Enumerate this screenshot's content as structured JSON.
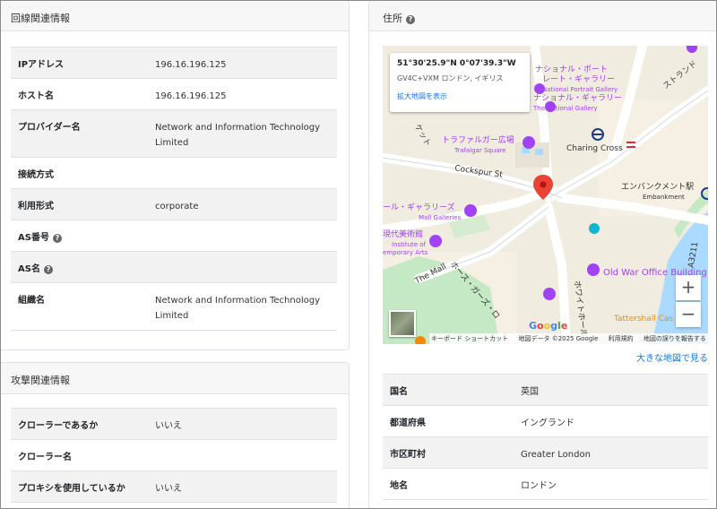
{
  "left_card": {
    "title": "回線関連情報",
    "rows": [
      {
        "key": "IPアドレス",
        "value": "196.16.196.125"
      },
      {
        "key": "ホスト名",
        "value": "196.16.196.125"
      },
      {
        "key": "プロバイダー名",
        "value": "Network and Information Technology Limited"
      },
      {
        "key": "接続方式",
        "value": ""
      },
      {
        "key": "利用形式",
        "value": "corporate"
      },
      {
        "key": "AS番号",
        "value": ""
      },
      {
        "key": "AS名",
        "value": ""
      },
      {
        "key": "組織名",
        "value": "Network and Information Technology Limited"
      }
    ],
    "help_symbol": "?"
  },
  "attack_card": {
    "title": "攻撃関連情報",
    "rows": [
      {
        "key": "クローラーであるか",
        "value": "いいえ"
      },
      {
        "key": "クローラー名",
        "value": ""
      },
      {
        "key": "プロキシを使用しているか",
        "value": "いいえ"
      }
    ]
  },
  "address_card": {
    "title": "住所",
    "larger_map_link": "大きな地図で見る",
    "rows": [
      {
        "key": "国名",
        "value": "英国"
      },
      {
        "key": "都道府県",
        "value": "イングランド"
      },
      {
        "key": "市区町村",
        "value": "Greater London"
      },
      {
        "key": "地名",
        "value": "ロンドン"
      }
    ]
  },
  "map": {
    "coordinates": "51°30'25.9\"N 0°07'39.3\"W",
    "plus_code": "GV4C+VXM ロンドン, イギリス",
    "view_larger_link": "拡大地図を表示",
    "labels": {
      "national_portrait_ja": "ナショナル・ポート",
      "national_portrait_ja2": "レート・ギャラリー",
      "national_portrait_en": "National Portrait Gallery",
      "national_gallery_ja": "ナショナル・ギャラリー",
      "national_gallery_en": "The National Gallery",
      "strand": "ストランド",
      "trafalgar_ja": "トラファルガー広場",
      "trafalgar_en": "Trafalgar Square",
      "charing_cross": "Charing Cross",
      "cockspur": "Cockspur St",
      "embankment_ja": "エンバンクメント駅",
      "embankment_en": "Embankment",
      "mall_galleries_ja": "ール・ギャラリーズ",
      "mall_galleries_en": "Mall Galleries",
      "ica_ja": "現代美術館",
      "ica_en1": "Institute of",
      "ica_en2": "emporary Arts",
      "the_mall": "The Mall",
      "horse_guards": "ホース・ガーズ・ロ",
      "whitehall": "ホワイトホール",
      "old_war_office": "Old War Office Building",
      "a3211": "A3211",
      "tattershall": "Tattershall Cas",
      "gallery_ga": "ギャ",
      "trafalgar_ket": "ケット"
    },
    "google_logo": "Google",
    "attribution": [
      "キーボード ショートカット",
      "地図データ ©2025 Google",
      "利用規約",
      "地図の誤りを報告する"
    ],
    "zoom_in": "+",
    "zoom_out": "−",
    "colors": {
      "pin": "#ea4335",
      "poi_purple": "#a142f4",
      "water": "#aadaff",
      "park": "#c5e8c5"
    }
  }
}
